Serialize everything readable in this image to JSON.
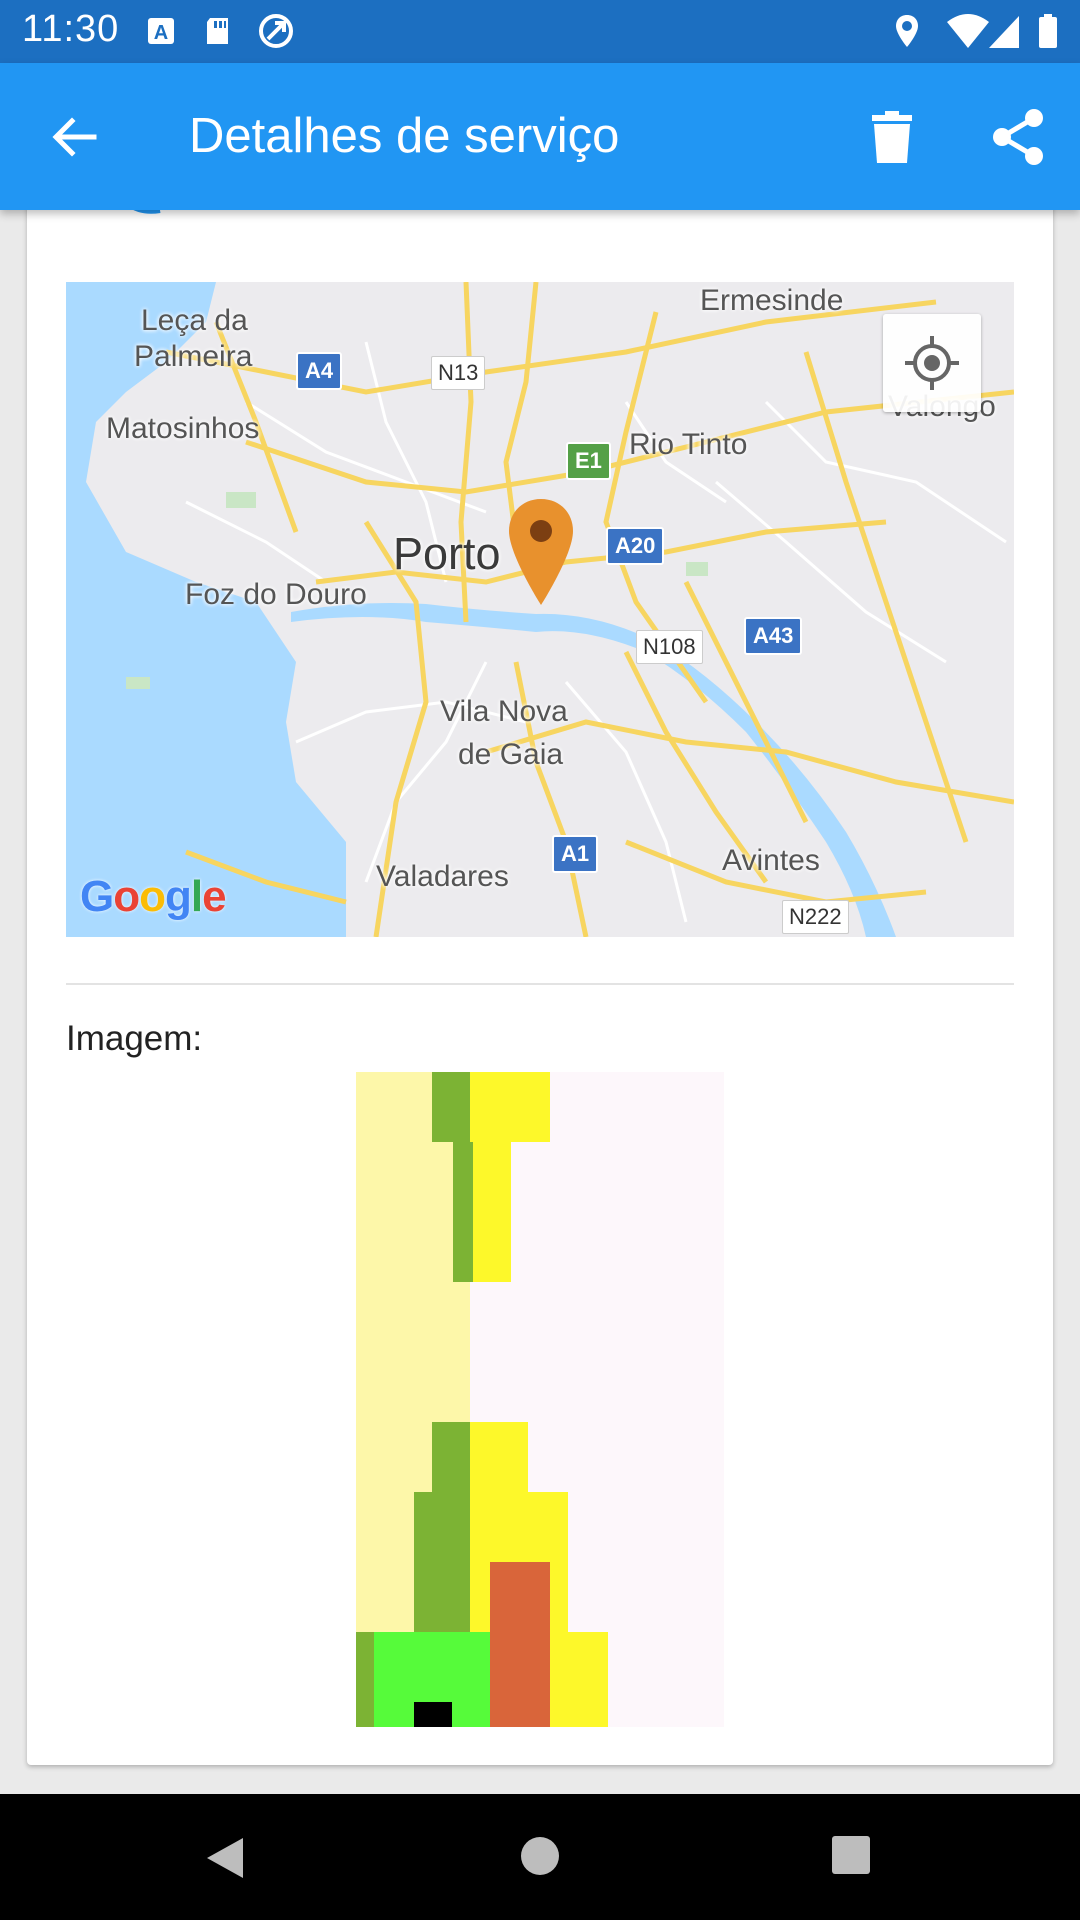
{
  "status_bar": {
    "time": "11:30",
    "left_icons": [
      "text-a-icon",
      "sd-card-icon",
      "sync-icon"
    ],
    "right_icons": [
      "location-icon",
      "wifi-icon",
      "signal-icon",
      "battery-icon"
    ]
  },
  "app_bar": {
    "title": "Detalhes de serviço",
    "back_icon": "arrow-left-icon",
    "delete_icon": "trash-icon",
    "share_icon": "share-icon",
    "background": "#2196f3"
  },
  "map": {
    "labels": {
      "leca": "Leça da",
      "palmeira": "Palmeira",
      "matosinhos": "Matosinhos",
      "ermesinde": "Ermesinde",
      "valongo": "Valongo",
      "rio_tinto": "Rio Tinto",
      "porto": "Porto",
      "foz": "Foz do Douro",
      "vila_nova": "Vila Nova",
      "de_gaia": "de Gaia",
      "avintes": "Avintes",
      "valadares": "Valadares"
    },
    "shields": {
      "a4": "A4",
      "n13": "N13",
      "e1": "E1",
      "a20": "A20",
      "n108": "N108",
      "a43": "A43",
      "a1": "A1",
      "n222": "N222"
    },
    "logo": "Google",
    "marker_color": "#e8912d"
  },
  "image_section": {
    "label": "Imagem:"
  },
  "nav_bar": {
    "icons": [
      "back-triangle-icon",
      "home-circle-icon",
      "recents-square-icon"
    ]
  }
}
